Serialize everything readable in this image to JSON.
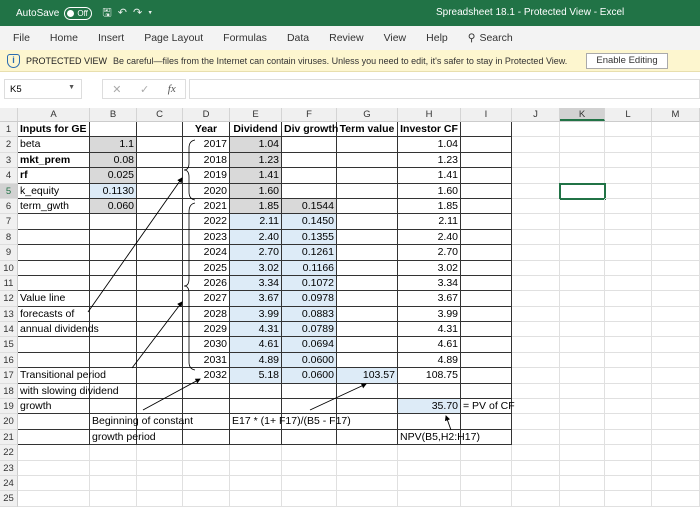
{
  "titlebar": {
    "autosave": "AutoSave",
    "toggle": "Off",
    "title": "Spreadsheet 18.1  -  Protected View  -  Excel"
  },
  "menu": [
    "File",
    "Home",
    "Insert",
    "Page Layout",
    "Formulas",
    "Data",
    "Review",
    "View",
    "Help",
    "Search"
  ],
  "protected": {
    "label": "PROTECTED VIEW",
    "message": "Be careful—files from the Internet can contain viruses. Unless you need to edit, it's safer to stay in Protected View.",
    "button": "Enable Editing"
  },
  "formula_bar": {
    "name_box": "K5",
    "fx": "fx",
    "value": ""
  },
  "columns": [
    "A",
    "B",
    "C",
    "D",
    "E",
    "F",
    "G",
    "H",
    "I",
    "J",
    "K",
    "L",
    "M"
  ],
  "selected_cell": "K5",
  "colors": {
    "gray_fill": "#d9d9d9",
    "blue_fill": "#ddebf7",
    "accent": "#217346"
  },
  "rows": [
    [
      "Inputs for GE",
      "",
      "",
      "Year",
      "Dividend",
      "Div growth",
      "Term value",
      "Investor CF",
      ""
    ],
    [
      "beta",
      "1.1",
      "",
      "2017",
      "1.04",
      "",
      "",
      "1.04",
      ""
    ],
    [
      "mkt_prem",
      "0.08",
      "",
      "2018",
      "1.23",
      "",
      "",
      "1.23",
      ""
    ],
    [
      "rf",
      "0.025",
      "",
      "2019",
      "1.41",
      "",
      "",
      "1.41",
      ""
    ],
    [
      "k_equity",
      "0.1130",
      "",
      "2020",
      "1.60",
      "",
      "",
      "1.60",
      ""
    ],
    [
      "term_gwth",
      "0.060",
      "",
      "2021",
      "1.85",
      "0.1544",
      "",
      "1.85",
      ""
    ],
    [
      "",
      "",
      "",
      "2022",
      "2.11",
      "0.1450",
      "",
      "2.11",
      ""
    ],
    [
      "",
      "",
      "",
      "2023",
      "2.40",
      "0.1355",
      "",
      "2.40",
      ""
    ],
    [
      "",
      "",
      "",
      "2024",
      "2.70",
      "0.1261",
      "",
      "2.70",
      ""
    ],
    [
      "",
      "",
      "",
      "2025",
      "3.02",
      "0.1166",
      "",
      "3.02",
      ""
    ],
    [
      "",
      "",
      "",
      "2026",
      "3.34",
      "0.1072",
      "",
      "3.34",
      ""
    ],
    [
      "Value line",
      "",
      "",
      "2027",
      "3.67",
      "0.0978",
      "",
      "3.67",
      ""
    ],
    [
      "forecasts of",
      "",
      "",
      "2028",
      "3.99",
      "0.0883",
      "",
      "3.99",
      ""
    ],
    [
      "annual dividends",
      "",
      "",
      "2029",
      "4.31",
      "0.0789",
      "",
      "4.31",
      ""
    ],
    [
      "",
      "",
      "",
      "2030",
      "4.61",
      "0.0694",
      "",
      "4.61",
      ""
    ],
    [
      "",
      "",
      "",
      "2031",
      "4.89",
      "0.0600",
      "",
      "4.89",
      ""
    ],
    [
      "Transitional period",
      "",
      "",
      "2032",
      "5.18",
      "0.0600",
      "103.57",
      "108.75",
      ""
    ],
    [
      "with slowing dividend",
      "",
      "",
      "",
      "",
      "",
      "",
      "",
      ""
    ],
    [
      "growth",
      "",
      "",
      "",
      "",
      "",
      "",
      "35.70",
      "= PV of CF"
    ],
    [
      "",
      "Beginning of constant",
      "",
      "",
      "E17 * (1+ F17)/(B5 - F17)",
      "",
      "",
      "",
      ""
    ],
    [
      "",
      "growth period",
      "",
      "",
      "",
      "",
      "",
      "NPV(B5,H2:H17)",
      ""
    ],
    [],
    [],
    [],
    []
  ],
  "gray_cells": [
    "B2",
    "B3",
    "B4",
    "B6",
    "E2",
    "E3",
    "E4",
    "E5",
    "E6",
    "F6"
  ],
  "blue_cells": [
    "B5",
    "E7",
    "E8",
    "E9",
    "E10",
    "E11",
    "E12",
    "E13",
    "E14",
    "E15",
    "E16",
    "E17",
    "F7",
    "F8",
    "F9",
    "F10",
    "F11",
    "F12",
    "F13",
    "F14",
    "F15",
    "F16",
    "F17",
    "G17",
    "H19"
  ],
  "bold_cells": [
    "A1",
    "A3",
    "A4",
    "D1",
    "E1",
    "F1",
    "G1",
    "H1"
  ]
}
